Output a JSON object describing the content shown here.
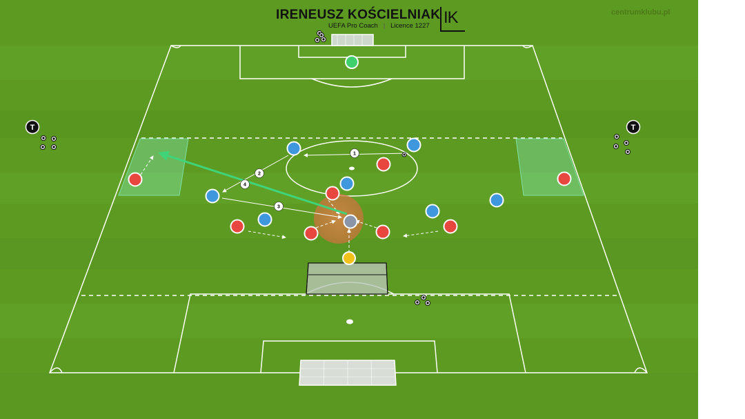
{
  "header": {
    "coach_name": "IRENEUSZ KOŚCIELNIAK",
    "credential": "UEFA Pro Coach",
    "separator": "|",
    "licence": "Licence 1227",
    "logo_text": "IK",
    "website": "centrumklubu.pl"
  },
  "colors": {
    "grass_dark": "#4f8f1c",
    "grass_light": "#6aa82b",
    "line_white": "#ffffff",
    "team_red": "#e8473f",
    "team_blue": "#3f97de",
    "goalkeeper_green": "#3fcf6d",
    "joker_yellow": "#f2c21b",
    "highlight_zone": "#d98a45",
    "wide_zone": "#73d99a",
    "pass_arrow_green": "#3fd37a",
    "center_player_grey": "#8a96a8"
  },
  "sequence": {
    "pass_numbers": [
      "1",
      "2",
      "3",
      "4"
    ]
  },
  "icons": {
    "coach_marker": "T",
    "ball_icon": "soccer-ball-icon"
  }
}
